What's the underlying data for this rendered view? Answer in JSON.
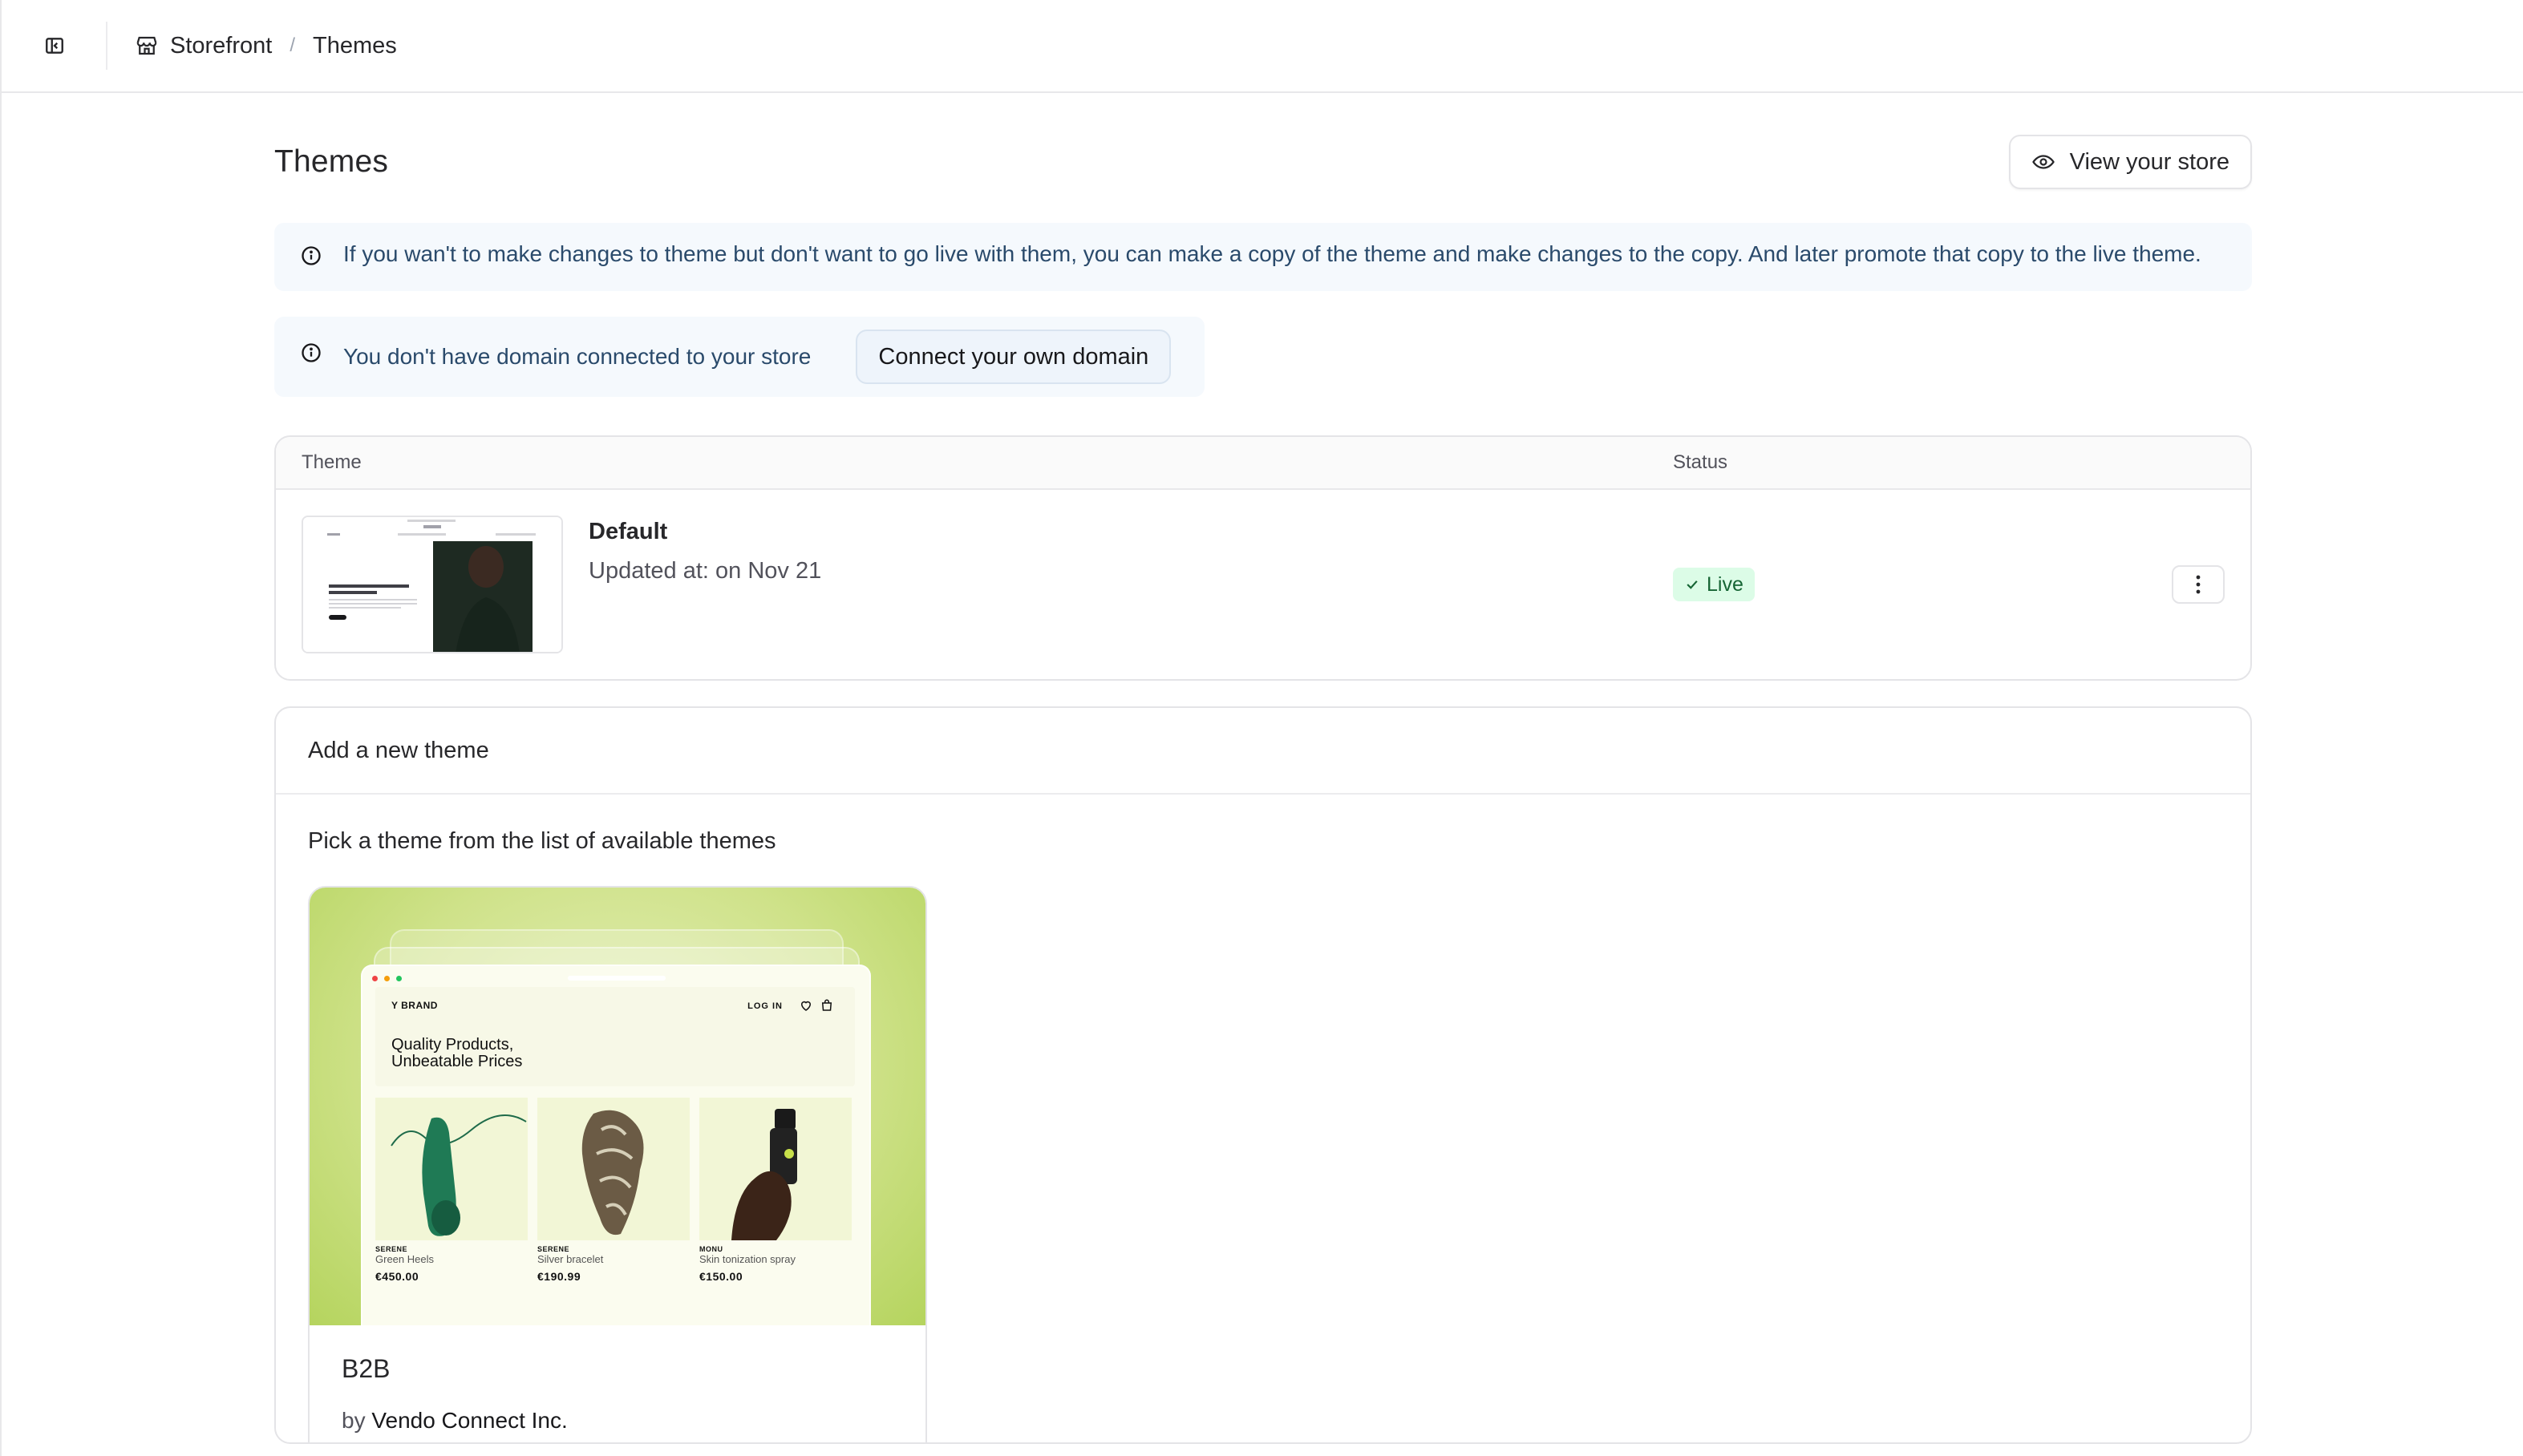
{
  "topbar": {
    "breadcrumb": [
      {
        "label": "Storefront",
        "icon": "store-icon"
      },
      {
        "label": "Themes"
      }
    ],
    "separator": "/"
  },
  "page": {
    "title": "Themes",
    "view_store_label": "View your store"
  },
  "callouts": {
    "copy_info": "If you wan't to make changes to theme but don't want to go live with them, you can make a copy of the theme and make changes to the copy. And later promote that copy to the live theme.",
    "domain_info": "You don't have domain connected to your store",
    "domain_button": "Connect your own domain"
  },
  "table": {
    "columns": [
      "Theme",
      "Status"
    ],
    "rows": [
      {
        "name": "Default",
        "updated": "Updated at: on Nov 21",
        "status": "Live"
      }
    ]
  },
  "add_theme": {
    "title": "Add a new theme",
    "subtitle": "Pick a theme from the list of available themes",
    "themes": [
      {
        "name": "B2B",
        "by_prefix": "by",
        "author": "Vendo Connect Inc.",
        "preview": {
          "brand": "Y BRAND",
          "login": "LOG IN",
          "headline_line1": "Quality Products,",
          "headline_line2": "Unbeatable Prices",
          "products": [
            {
              "brand": "SERENE",
              "name": "Green Heels",
              "price": "€450.00"
            },
            {
              "brand": "SERENE",
              "name": "Silver bracelet",
              "price": "€190.99"
            },
            {
              "brand": "MONU",
              "name": "Skin tonization spray",
              "price": "€150.00"
            }
          ]
        }
      }
    ]
  },
  "colors": {
    "callout_bg": "#f5f9fd",
    "callout_text": "#2a4a6b",
    "live_badge_bg": "#dcfce7",
    "live_badge_text": "#166534",
    "theme_preview_green": "#cfe28a"
  }
}
